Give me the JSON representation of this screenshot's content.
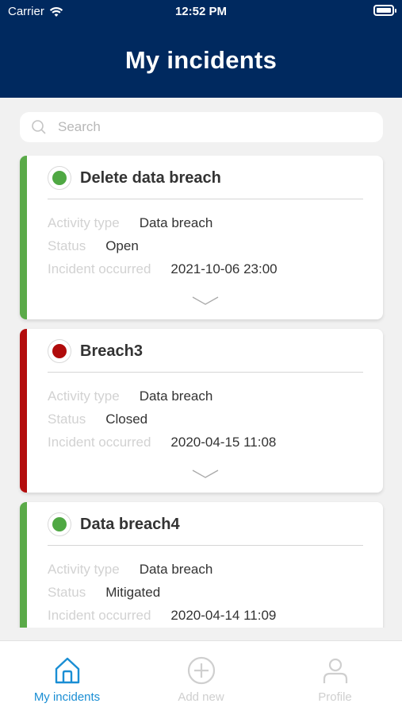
{
  "status_bar": {
    "carrier": "Carrier",
    "time": "12:52 PM"
  },
  "header": {
    "title": "My incidents"
  },
  "search": {
    "placeholder": "Search"
  },
  "incidents": [
    {
      "name": "Delete data breach",
      "status_color": "#4fa843",
      "accent_color": "#5aaa48",
      "activity_label": "Activity type",
      "activity": "Data breach",
      "status_label": "Status",
      "status": "Open",
      "occurred_label": "Incident occurred",
      "occurred": "2021-10-06 23:00"
    },
    {
      "name": "Breach3",
      "status_color": "#b00b0b",
      "accent_color": "#b30d0d",
      "activity_label": "Activity type",
      "activity": "Data breach",
      "status_label": "Status",
      "status": "Closed",
      "occurred_label": "Incident occurred",
      "occurred": "2020-04-15 11:08"
    },
    {
      "name": "Data breach4",
      "status_color": "#4fa843",
      "accent_color": "#5aaa48",
      "activity_label": "Activity type",
      "activity": "Data breach",
      "status_label": "Status",
      "status": "Mitigated",
      "occurred_label": "Incident occurred",
      "occurred": "2020-04-14 11:09"
    }
  ],
  "tabbar": {
    "active_color": "#1a8ed4",
    "inactive_color": "#cfcfcf",
    "tabs": [
      {
        "label": "My incidents",
        "icon": "home-icon",
        "active": true
      },
      {
        "label": "Add new",
        "icon": "plus-circle-icon",
        "active": false
      },
      {
        "label": "Profile",
        "icon": "person-icon",
        "active": false
      }
    ]
  }
}
